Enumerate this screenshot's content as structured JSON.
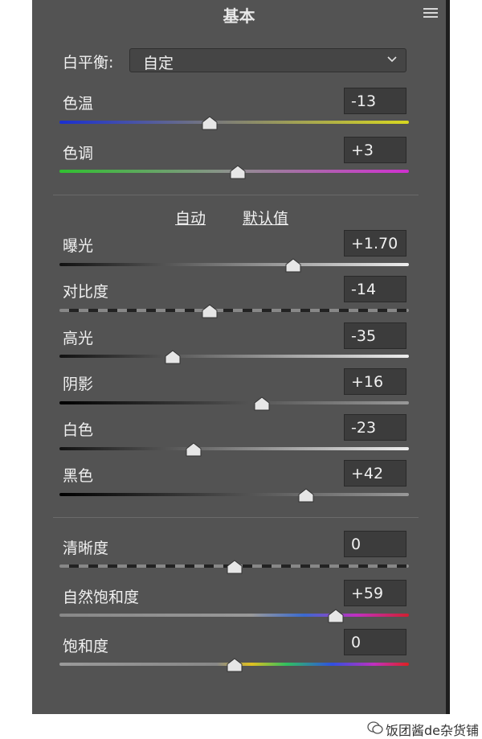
{
  "panel": {
    "title": "基本"
  },
  "white_balance": {
    "label": "白平衡:",
    "value": "自定"
  },
  "links": {
    "auto": "自动",
    "default": "默认值"
  },
  "sliders": [
    {
      "label": "色温",
      "value": "-13",
      "level": 0.43,
      "track": "temp"
    },
    {
      "label": "色调",
      "value": "+3",
      "level": 0.51,
      "track": "tint"
    },
    {
      "label": "曝光",
      "value": "+1.70",
      "level": 0.67,
      "track": "gray"
    },
    {
      "label": "对比度",
      "value": "-14",
      "level": 0.43,
      "track": "contrast"
    },
    {
      "label": "高光",
      "value": "-35",
      "level": 0.325,
      "track": "gray"
    },
    {
      "label": "阴影",
      "value": "+16",
      "level": 0.58,
      "track": "dark"
    },
    {
      "label": "白色",
      "value": "-23",
      "level": 0.385,
      "track": "gray"
    },
    {
      "label": "黑色",
      "value": "+42",
      "level": 0.705,
      "track": "dark"
    },
    {
      "label": "清晰度",
      "value": "0",
      "level": 0.5,
      "track": "contrast"
    },
    {
      "label": "自然饱和度",
      "value": "+59",
      "level": 0.79,
      "track": "vibrance"
    },
    {
      "label": "饱和度",
      "value": "0",
      "level": 0.5,
      "track": "saturation"
    }
  ],
  "watermark": {
    "text": "饭团酱de杂货铺",
    "icon": "wechat-icon"
  }
}
